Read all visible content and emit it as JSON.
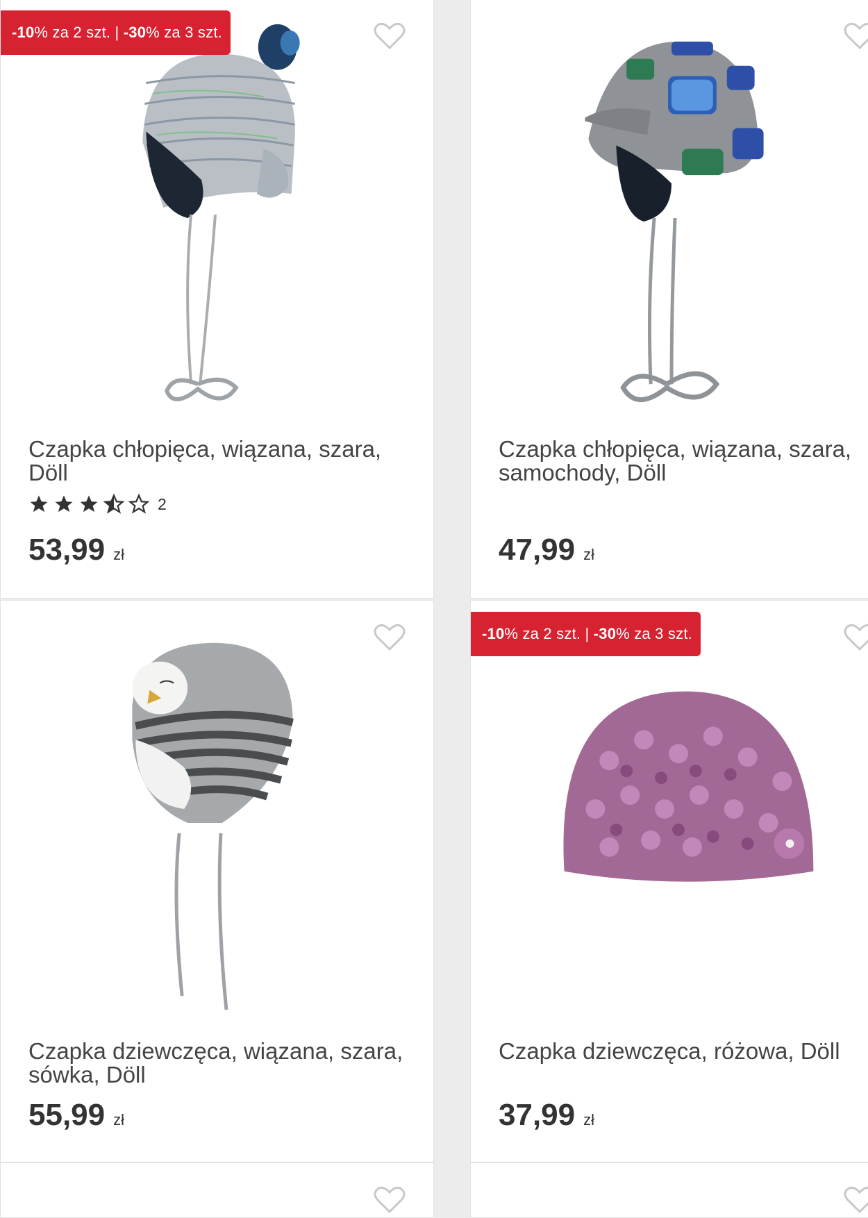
{
  "colors": {
    "promo_bg": "#d62231",
    "background": "#ececec",
    "card_bg": "#ffffff"
  },
  "products": [
    {
      "title": "Czapka chłopięca, wiązana, szara, Döll",
      "promo": {
        "first_pct": "-10",
        "first_rest": "% za 2 szt. |",
        "second_pct": "-30",
        "second_rest": "% za 3 szt."
      },
      "rating": {
        "value": 3.5,
        "max": 5,
        "count": "2"
      },
      "price": "53,99",
      "currency": "zł",
      "icon": "heart-icon"
    },
    {
      "title": "Czapka chłopięca, wiązana, szara, samochody, Döll",
      "price": "47,99",
      "currency": "zł",
      "icon": "heart-icon"
    },
    {
      "title": "Czapka dziewczęca, wiązana, szara, sówka, Döll",
      "price": "55,99",
      "currency": "zł",
      "icon": "heart-icon"
    },
    {
      "title": "Czapka dziewczęca, różowa, Döll",
      "promo": {
        "first_pct": "-10",
        "first_rest": "% za 2 szt. |",
        "second_pct": "-30",
        "second_rest": "% za 3 szt."
      },
      "price": "37,99",
      "currency": "zł",
      "icon": "heart-icon"
    }
  ]
}
